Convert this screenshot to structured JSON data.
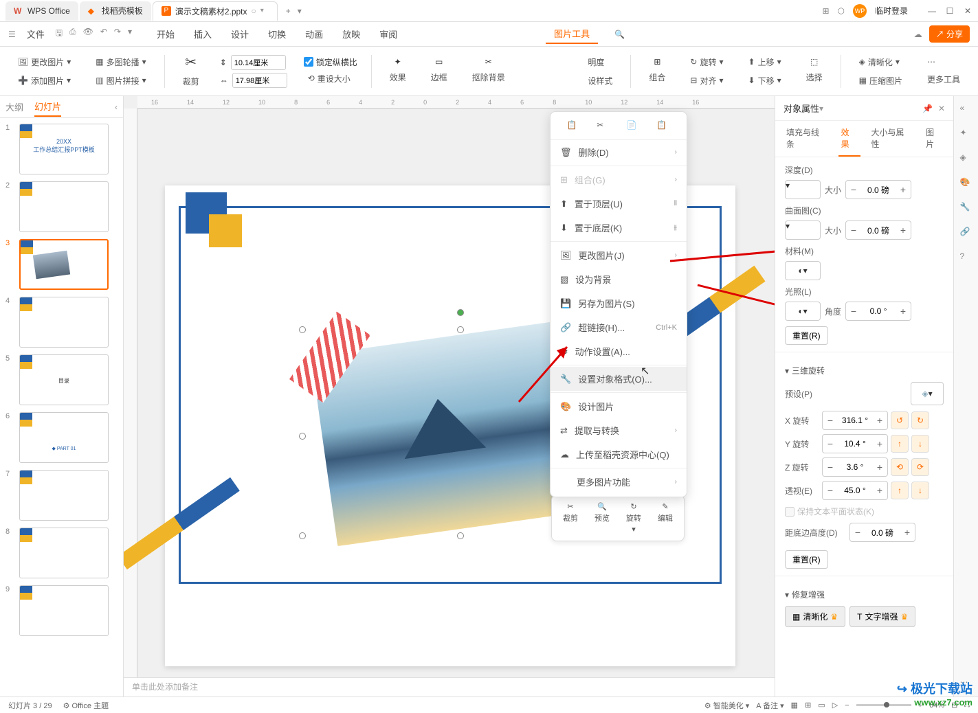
{
  "titlebar": {
    "tabs": [
      {
        "icon": "W",
        "iconColor": "#d94f3a",
        "label": "WPS Office"
      },
      {
        "icon": "◆",
        "iconColor": "#ff6a00",
        "label": "找稻壳模板"
      },
      {
        "icon": "P",
        "iconColor": "#ff6a00",
        "label": "演示文稿素材2.pptx"
      }
    ],
    "login": "临时登录"
  },
  "menubar": {
    "file": "文件",
    "items": [
      "开始",
      "插入",
      "设计",
      "切换",
      "动画",
      "放映",
      "审阅"
    ],
    "imageTools": "图片工具",
    "share": "分享"
  },
  "toolbar": {
    "changeImage": "更改图片",
    "addImage": "添加图片",
    "multiContour": "多图轮播",
    "imageStitch": "图片拼接",
    "crop": "裁剪",
    "width": "10.14厘米",
    "height": "17.98厘米",
    "lockRatio": "锁定纵横比",
    "resetSize": "重设大小",
    "effects": "效果",
    "border": "边框",
    "removeBg": "抠除背景",
    "setStyle": "设样式",
    "group": "组合",
    "align": "对齐",
    "rotate": "旋转",
    "moveUp": "上移",
    "moveDown": "下移",
    "select": "选择",
    "clarity": "清晰化",
    "compress": "压缩图片",
    "moreTools": "更多工具",
    "brightness": "明度"
  },
  "slidesPanel": {
    "tabs": {
      "outline": "大纲",
      "slides": "幻灯片"
    }
  },
  "contextMenu": {
    "delete": "删除(D)",
    "group": "组合(G)",
    "bringFront": "置于顶层(U)",
    "sendBack": "置于底层(K)",
    "changeImg": "更改图片(J)",
    "setBg": "设为背景",
    "saveAs": "另存为图片(S)",
    "hyperlink": "超链接(H)...",
    "hyperlinkShortcut": "Ctrl+K",
    "actionSettings": "动作设置(A)...",
    "objectFormat": "设置对象格式(O)...",
    "designImg": "设计图片",
    "extractConvert": "提取与转换",
    "uploadResource": "上传至稻壳资源中心(Q)",
    "moreImgFunc": "更多图片功能"
  },
  "miniToolbar": {
    "crop": "裁剪",
    "preview": "预览",
    "rotate": "旋转",
    "edit": "编辑"
  },
  "propsPanel": {
    "title": "对象属性",
    "tabs": {
      "fill": "填充与线条",
      "effect": "效果",
      "sizeProps": "大小与属性",
      "image": "图片"
    },
    "depth": "深度(D)",
    "size": "大小",
    "depthVal": "0.0 磅",
    "curve": "曲面图(C)",
    "curveVal": "0.0 磅",
    "material": "材料(M)",
    "light": "光照(L)",
    "angle": "角度",
    "angleVal": "0.0 °",
    "reset": "重置(R)",
    "rotation3d": "三维旋转",
    "preset": "预设(P)",
    "xRot": "X 旋转",
    "xRotVal": "316.1 °",
    "yRot": "Y 旋转",
    "yRotVal": "10.4 °",
    "zRot": "Z 旋转",
    "zRotVal": "3.6 °",
    "perspective": "透视(E)",
    "perspectiveVal": "45.0 °",
    "keepTextFlat": "保持文本平面状态(K)",
    "distFromGround": "距底边高度(D)",
    "distVal": "0.0 磅",
    "repairEnhance": "修复增强",
    "clarityBtn": "清晰化",
    "textEnhance": "文字增强"
  },
  "notes": "单击此处添加备注",
  "statusbar": {
    "slideCount": "幻灯片 3 / 29",
    "theme": "Office 主题",
    "notes": "备注",
    "smartBeauty": "智能美化",
    "zoom": "64%"
  },
  "ruler": [
    "16",
    "14",
    "12",
    "10",
    "8",
    "6",
    "4",
    "2",
    "0",
    "2",
    "4",
    "6",
    "8",
    "10",
    "12",
    "14",
    "16"
  ],
  "watermark": {
    "site": "极光下载站",
    "url": "www.xz7.com"
  }
}
